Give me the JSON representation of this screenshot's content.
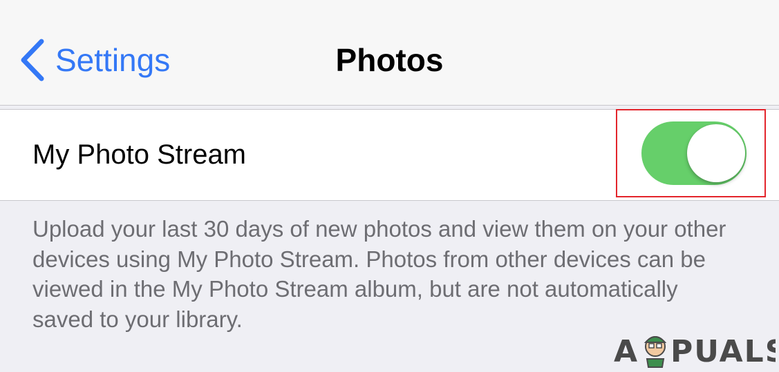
{
  "nav": {
    "back_label": "Settings",
    "title": "Photos"
  },
  "settings_row": {
    "label": "My Photo Stream",
    "toggle_state": "on"
  },
  "footer": {
    "description": "Upload your last 30 days of new photos and view them on your other devices using My Photo Stream. Photos from other devices can be viewed in the My Photo Stream album, but are not automatically saved to your library."
  },
  "watermark": {
    "text": "APPUALS"
  },
  "colors": {
    "accent": "#3478f6",
    "toggle_on": "#66cf6a",
    "highlight": "#e3242b"
  }
}
